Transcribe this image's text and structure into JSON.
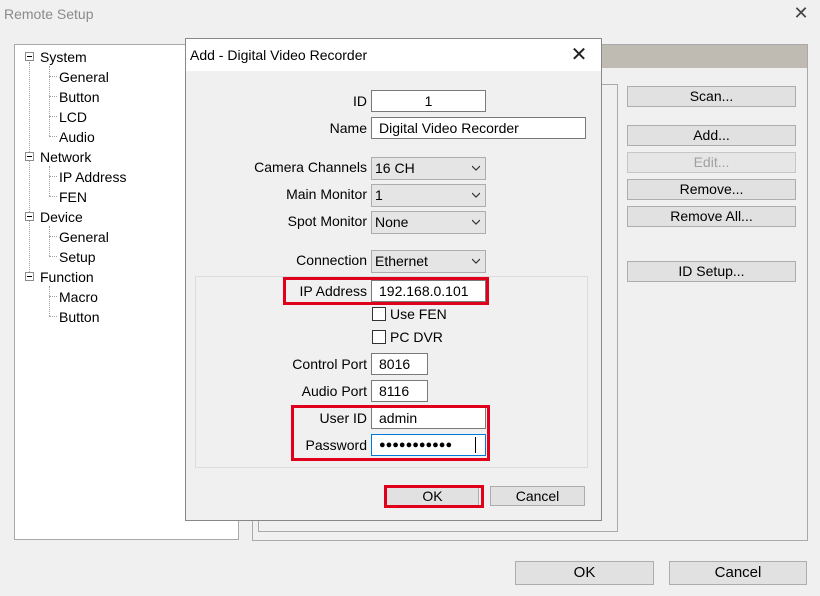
{
  "window": {
    "title": "Remote Setup",
    "close_glyph": "✕"
  },
  "tree": {
    "items": [
      {
        "label": "System"
      },
      {
        "label": "General"
      },
      {
        "label": "Button"
      },
      {
        "label": "LCD"
      },
      {
        "label": "Audio"
      },
      {
        "label": "Network"
      },
      {
        "label": "IP Address"
      },
      {
        "label": "FEN"
      },
      {
        "label": "Device"
      },
      {
        "label": "General"
      },
      {
        "label": "Setup"
      },
      {
        "label": "Function"
      },
      {
        "label": "Macro"
      },
      {
        "label": "Button"
      }
    ]
  },
  "side_buttons": {
    "scan": "Scan...",
    "add": "Add...",
    "edit": "Edit...",
    "remove": "Remove...",
    "remove_all": "Remove All...",
    "id_setup": "ID Setup..."
  },
  "footer": {
    "ok": "OK",
    "cancel": "Cancel"
  },
  "dialog": {
    "title": "Add - Digital Video Recorder",
    "close_glyph": "✕",
    "id_label": "ID",
    "id_value": "1",
    "name_label": "Name",
    "name_value": "Digital Video Recorder",
    "camera_channels_label": "Camera Channels",
    "camera_channels_value": "16 CH",
    "main_monitor_label": "Main Monitor",
    "main_monitor_value": "1",
    "spot_monitor_label": "Spot Monitor",
    "spot_monitor_value": "None",
    "connection_label": "Connection",
    "connection_value": "Ethernet",
    "ip_label": "IP Address",
    "ip_value": "192.168.0.101",
    "use_fen_label": "Use FEN",
    "use_fen_checked": false,
    "pc_dvr_label": "PC DVR",
    "pc_dvr_checked": false,
    "control_port_label": "Control Port",
    "control_port_value": "8016",
    "audio_port_label": "Audio Port",
    "audio_port_value": "8116",
    "user_id_label": "User ID",
    "user_id_value": "admin",
    "password_label": "Password",
    "password_value": "●●●●●●●●●●●",
    "ok": "OK",
    "cancel": "Cancel"
  },
  "colors": {
    "highlight_red": "#e0001b",
    "header_band": "#bfbbb2",
    "button_face": "#e1e1e1"
  }
}
